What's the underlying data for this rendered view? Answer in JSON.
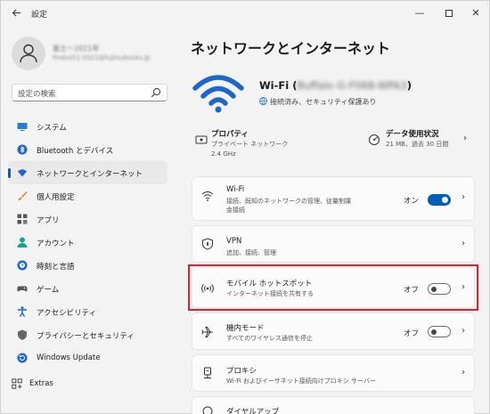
{
  "app": {
    "title": "設定"
  },
  "window_controls": {
    "minimize": "—",
    "close": "✕"
  },
  "profile": {
    "name": "富士一2021年",
    "email": "fmdvd11-2021@fujitsubooks.jp"
  },
  "search": {
    "placeholder": "設定の検索"
  },
  "sidebar": {
    "items": [
      {
        "label": "システム",
        "icon": "monitor-icon",
        "color": "#2b7cd3"
      },
      {
        "label": "Bluetooth とデバイス",
        "icon": "bluetooth-icon",
        "color": "#1e66c9"
      },
      {
        "label": "ネットワークとインターネット",
        "icon": "wifi-icon",
        "color": "#1e66c9",
        "active": true
      },
      {
        "label": "個人用設定",
        "icon": "brush-icon",
        "color": "#e1792a"
      },
      {
        "label": "アプリ",
        "icon": "apps-icon",
        "color": "#555555"
      },
      {
        "label": "アカウント",
        "icon": "person-icon",
        "color": "#1aa38c"
      },
      {
        "label": "時刻と言語",
        "icon": "clock-globe-icon",
        "color": "#1e66c9"
      },
      {
        "label": "ゲーム",
        "icon": "gamepad-icon",
        "color": "#555555"
      },
      {
        "label": "アクセシビリティ",
        "icon": "accessibility-icon",
        "color": "#1e66c9"
      },
      {
        "label": "プライバシーとセキュリティ",
        "icon": "shield-icon",
        "color": "#666666"
      },
      {
        "label": "Windows Update",
        "icon": "update-icon",
        "color": "#1e66c9"
      }
    ],
    "extras": {
      "label": "Extras",
      "icon": "grid-plus-icon"
    }
  },
  "main": {
    "title": "ネットワークとインターネット",
    "hero": {
      "name": "Wi-Fi (",
      "ssid": "Buffalo-G-F068-WPA3",
      "name_suffix": ")",
      "status": "接続済み、セキュリティ保護あり"
    },
    "properties": {
      "title": "プロパティ",
      "line1": "プライベート ネットワーク",
      "line2": "2.4 GHz"
    },
    "data_usage": {
      "title": "データ使用状況",
      "subtitle": "21 MB、過去 30 日間"
    },
    "cards": [
      {
        "name": "wifi",
        "title": "Wi-Fi",
        "sub1": "接続、既知のネットワークの管理、従量制課",
        "sub2": "金接続",
        "state": "オン",
        "toggle": "on"
      },
      {
        "name": "vpn",
        "title": "VPN",
        "sub1": "追加、接続、管理"
      },
      {
        "name": "mobile-hotspot",
        "title": "モバイル ホットスポット",
        "sub1": "インターネット接続を共有する",
        "state": "オフ",
        "toggle": "off"
      },
      {
        "name": "airplane-mode",
        "title": "機内モード",
        "sub1": "すべてのワイヤレス通信を停止",
        "state": "オフ",
        "toggle": "off"
      },
      {
        "name": "proxy",
        "title": "プロキシ",
        "sub1": "Wi-Fi およびイーサネット接続向けプロキシ サーバー"
      },
      {
        "name": "dialup",
        "title": "ダイヤルアップ"
      }
    ]
  },
  "colors": {
    "accent": "#005fb8",
    "highlight": "#e0202c"
  }
}
